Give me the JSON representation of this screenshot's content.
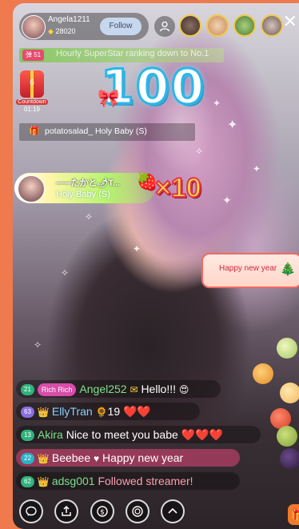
{
  "host": {
    "name": "Angela1211",
    "score": "28020",
    "follow_label": "Follow"
  },
  "banner": {
    "badge": "弹 51",
    "text": "Hourly SuperStar ranking down to No.1"
  },
  "countdown": {
    "gift_number": "6",
    "label": "Countdown",
    "time": "01:19"
  },
  "gift_counter": "100",
  "gift_notice": {
    "text": "potatosalad_  Holy Baby (S)"
  },
  "combo": {
    "sender": "⸺たかと🌶T...",
    "gift": "Holy Baby (S)",
    "multiplier": "×10"
  },
  "effect_bubble": "Happy new year",
  "chat": [
    {
      "level": "21",
      "level_color": "#2fb37c",
      "tag": "Rich Rich",
      "tag_color": "#d94ca8",
      "user": "Angel252",
      "user_style": "uname-green",
      "message": "Hello!!!"
    },
    {
      "level": "63",
      "level_color": "#8a6ee0",
      "tag": "",
      "user": "EllyTran",
      "user_style": "uname-blue",
      "message": "19 ❤️❤️"
    },
    {
      "level": "13",
      "level_color": "#2fb37c",
      "tag": "",
      "user": "Akira",
      "user_style": "uname-green",
      "message": "Nice to meet you babe ❤️❤️❤️"
    },
    {
      "level": "22",
      "level_color": "#28b3c6",
      "tag": "",
      "user": "Beebee",
      "user_style": "uname-white",
      "message": "Happy new year"
    },
    {
      "level": "62",
      "level_color": "#2fb37c",
      "tag": "",
      "user": "adsg001",
      "user_style": "uname-green",
      "message": "Followed streamer!"
    }
  ],
  "icons": {
    "close": "close-icon",
    "add_friend": "person-icon",
    "comment": "comment-icon",
    "share": "share-icon",
    "coin": "coin-icon",
    "effects": "ring-icon",
    "expand": "chevron-up-icon",
    "gift": "gift-icon"
  }
}
